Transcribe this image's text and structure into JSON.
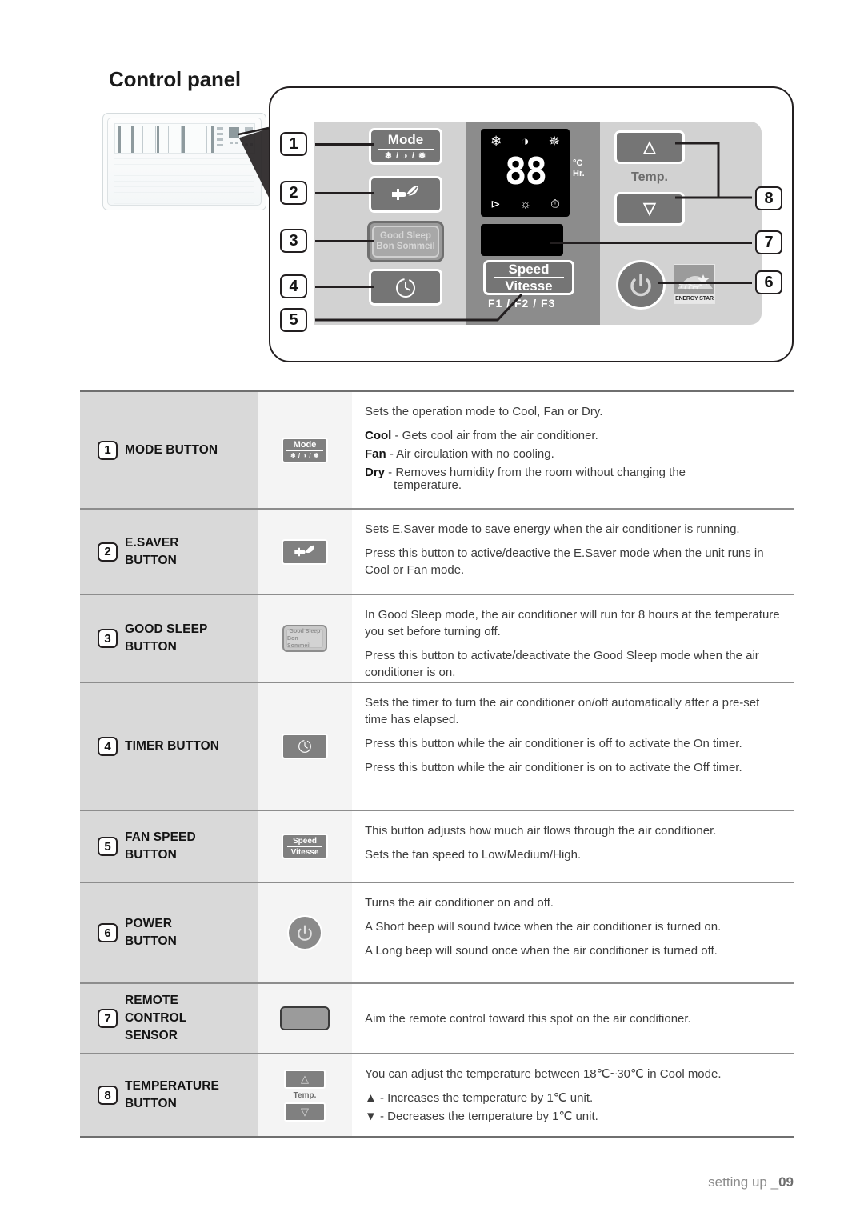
{
  "heading": "Control panel",
  "panel": {
    "mode_button": {
      "label": "Mode",
      "icons": "❄ / ◑ / ❅"
    },
    "esaver_button": {
      "icon_name": "plug-leaf-icon"
    },
    "good_sleep_button": {
      "line1": "Good Sleep",
      "line2": "Bon Sommeil"
    },
    "timer_button": {
      "icon_name": "clock-icon"
    },
    "display": {
      "top_icons": [
        "snowflake-icon",
        "water-drop-icon",
        "fan-icon"
      ],
      "digits": "88",
      "units_line1": "°C",
      "units_line2": "Hr.",
      "bottom_icons": [
        "plug-leaf-icon",
        "good-sleep-icon",
        "timer-clock-icon"
      ]
    },
    "speed_button": {
      "line1": "Speed",
      "line2": "Vitesse",
      "fan_levels": "F1 / F2 / F3"
    },
    "temp_label": "Temp.",
    "temp_up": "△",
    "temp_down": "▽",
    "power_button": {
      "icon_name": "power-icon"
    },
    "energy_star": {
      "text": "ENERGY STAR"
    },
    "callouts": [
      "1",
      "2",
      "3",
      "4",
      "5",
      "6",
      "7",
      "8"
    ]
  },
  "table": {
    "rows": [
      {
        "num": "1",
        "name": "MODE BUTTON",
        "thumb": "mode-button-thumb",
        "thumb_label": "Mode",
        "thumb_icons": "❄ / ◑ / ❅",
        "desc": [
          {
            "text": "Sets the operation mode to Cool, Fan or Dry."
          },
          {
            "bold": "Cool",
            "text": " - Gets cool air from the air conditioner."
          },
          {
            "bold": "Fan",
            "text": " - Air circulation with no cooling."
          },
          {
            "bold": "Dry",
            "text": " - Removes humidity from the room without changing the"
          },
          {
            "text": "temperature.",
            "indent": true
          }
        ]
      },
      {
        "num": "2",
        "name": "E.SAVER\nBUTTON",
        "thumb": "esaver-button-thumb",
        "desc": [
          {
            "text": "Sets E.Saver mode to save energy when the air conditioner is running."
          },
          {
            "text": " Press this button to active/deactive the E.Saver mode when the unit runs in Cool or Fan mode."
          }
        ]
      },
      {
        "num": "3",
        "name": "GOOD SLEEP\nBUTTON",
        "thumb": "good-sleep-button-thumb",
        "thumb_line1": "Good Sleep",
        "thumb_line2": "Bon Sommeil",
        "desc": [
          {
            "text": "In Good Sleep mode, the air conditioner will run for 8 hours at the temperature you set before turning off."
          },
          {
            "text": "Press this button to activate/deactivate the Good Sleep mode when the air conditioner is on."
          }
        ]
      },
      {
        "num": "4",
        "name": "TIMER BUTTON",
        "thumb": "timer-button-thumb",
        "desc": [
          {
            "text": "Sets the timer to turn the air conditioner on/off automatically after a pre-set time has elapsed."
          },
          {
            "text": "Press this button while the air conditioner is off to activate the On timer."
          },
          {
            "text": "Press this button while the air conditioner is on to activate the Off timer."
          }
        ]
      },
      {
        "num": "5",
        "name": "FAN SPEED\nBUTTON",
        "thumb": "fan-speed-button-thumb",
        "thumb_line1": "Speed",
        "thumb_line2": "Vitesse",
        "desc": [
          {
            "text": "This button adjusts how much air flows through the air conditioner."
          },
          {
            "text": "Sets the fan speed to Low/Medium/High."
          }
        ]
      },
      {
        "num": "6",
        "name": "POWER\nBUTTON",
        "thumb": "power-button-thumb",
        "desc": [
          {
            "text": "Turns the air conditioner on and off."
          },
          {
            "text": "A Short beep will sound twice when the air conditioner is turned on."
          },
          {
            "text": "A Long beep will sound once when the air conditioner is turned off."
          }
        ]
      },
      {
        "num": "7",
        "name": "REMOTE\nCONTROL\nSENSOR",
        "thumb": "remote-sensor-thumb",
        "desc": [
          {
            "text": "Aim the remote control toward this spot on the air conditioner."
          }
        ]
      },
      {
        "num": "8",
        "name": "TEMPERATURE\nBUTTON",
        "thumb": "temperature-button-thumb",
        "thumb_label": "Temp.",
        "thumb_up": "△",
        "thumb_down": "▽",
        "desc": [
          {
            "text": "You can adjust the temperature between 18℃~30℃ in Cool mode."
          },
          {
            "text": "▲ - Increases the temperature by 1℃ unit."
          },
          {
            "text": "▼ - Decreases the temperature by 1℃ unit."
          }
        ]
      }
    ]
  },
  "footer": {
    "label": "setting up _",
    "page": "09"
  },
  "colors": {
    "col1_bg": "#d9d9d9",
    "col2_bg": "#f4f4f4",
    "panel_gray": "#d2d2d2",
    "panel_dark": "#8c8c8c",
    "button_gray": "#757575"
  }
}
